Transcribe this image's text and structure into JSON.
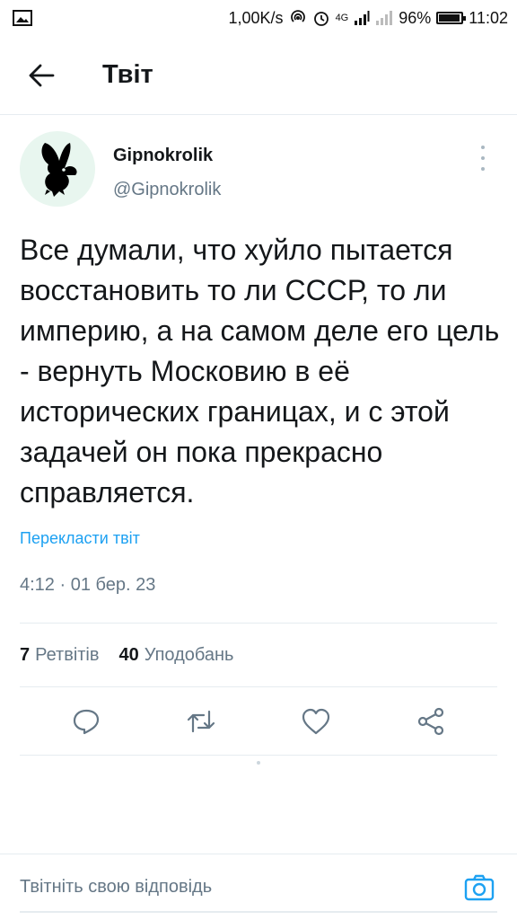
{
  "status_bar": {
    "net_speed": "1,00K/s",
    "network_type": "4G",
    "battery_percent": "96%",
    "battery_level": 0.96,
    "time": "11:02",
    "icons": [
      "image-icon",
      "hotspot-icon",
      "alarm-icon",
      "signal-icon",
      "signal-icon-2",
      "battery-icon"
    ]
  },
  "header": {
    "title": "Твіт",
    "back_icon": "arrow-left-icon"
  },
  "tweet": {
    "author_name": "Gipnokrolik",
    "author_handle": "@Gipnokrolik",
    "text": "Все думали, что хуйло пытается восстановить то ли СССР, то ли империю, а на самом деле его цель - вернуть Московию в её исторических границах, и с этой задачей он пока прекрасно справляется.",
    "translate_label": "Перекласти твіт",
    "timestamp": "4:12 · 01 бер. 23"
  },
  "stats": {
    "retweets_count": "7",
    "retweets_label": "Ретвітів",
    "likes_count": "40",
    "likes_label": "Уподобань"
  },
  "actions": [
    "reply-icon",
    "retweet-icon",
    "like-icon",
    "share-icon"
  ],
  "reply": {
    "placeholder": "Твітніть свою відповідь",
    "camera_icon": "camera-icon"
  },
  "colors": {
    "accent": "#1da1f2",
    "secondary_text": "#657786",
    "border": "#e6ecf0"
  }
}
